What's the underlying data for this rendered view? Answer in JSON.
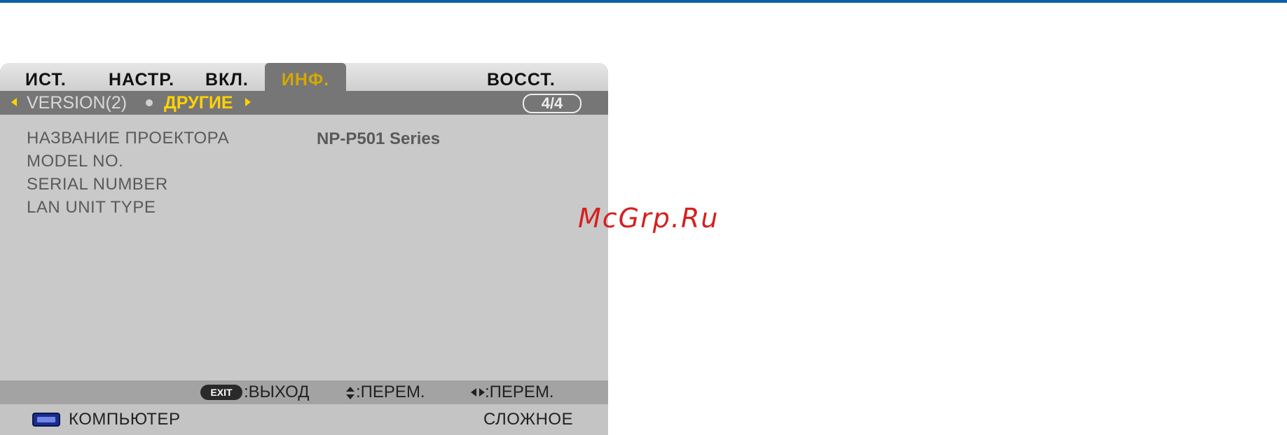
{
  "tabs": [
    {
      "label": "ИСТ."
    },
    {
      "label": "НАСТР."
    },
    {
      "label": "ВКЛ."
    },
    {
      "label": "ИНФ."
    },
    {
      "label": "ВОССТ."
    }
  ],
  "active_tab": "ИНФ.",
  "subnav": {
    "previous": "VERSION(2)",
    "current": "ДРУГИЕ",
    "page_indicator": "4/4"
  },
  "info_rows": [
    {
      "label": "НАЗВАНИЕ ПРОЕКТОРА",
      "value": "NP-P501 Series"
    },
    {
      "label": "MODEL NO.",
      "value": ""
    },
    {
      "label": "SERIAL NUMBER",
      "value": ""
    },
    {
      "label": "LAN UNIT TYPE",
      "value": ""
    }
  ],
  "footer_hints": {
    "exit_key": "EXIT",
    "exit_label": ":ВЫХОД",
    "updown_label": ":ПЕРЕМ.",
    "leftright_label": ":ПЕРЕМ."
  },
  "status": {
    "source": "КОМПЬЮТЕР",
    "mode": "СЛОЖНОЕ"
  },
  "watermark": "McGrp.Ru",
  "colors": {
    "accent_yellow": "#ffd200",
    "active_tab_text": "#d4a800",
    "subbar_bg": "#767676",
    "top_line": "#0b5fa5",
    "watermark": "#d52020"
  },
  "icons": [
    "triangle-left-icon",
    "triangle-right-icon",
    "updown-arrows-icon",
    "leftright-arrows-icon",
    "monitor-icon"
  ]
}
